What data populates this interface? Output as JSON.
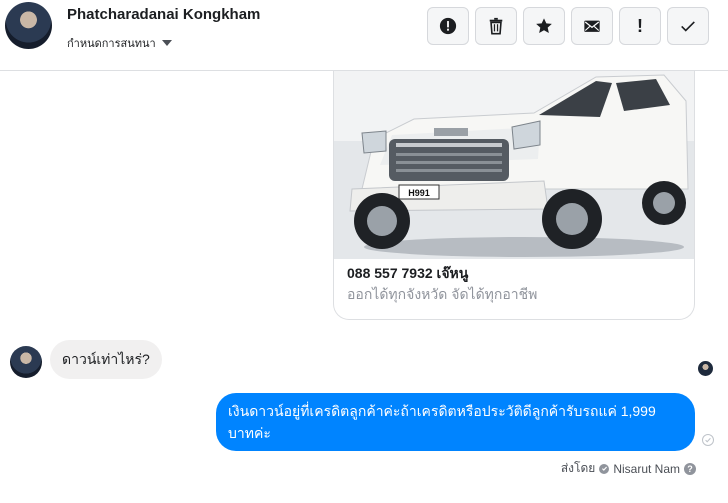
{
  "header": {
    "contact_name": "Phatcharadanai Kongkham",
    "settings_label": "กำหนดการสนทนา",
    "toolbar": [
      {
        "name": "mark-as-spam-button",
        "icon": "exclamation-circle-icon"
      },
      {
        "name": "delete-button",
        "icon": "trash-icon"
      },
      {
        "name": "star-button",
        "icon": "star-icon"
      },
      {
        "name": "mark-unread-button",
        "icon": "envelope-icon"
      },
      {
        "name": "follow-up-button",
        "icon": "exclamation-icon"
      },
      {
        "name": "mark-done-button",
        "icon": "checkmark-icon"
      }
    ]
  },
  "attachment": {
    "image_subject": "white Isuzu pickup truck",
    "plate_text": "H991",
    "title": "088 557 7932 เจ๊หนู",
    "subtitle": "ออกได้ทุกจังหวัด จัดได้ทุกอาชีพ"
  },
  "messages": {
    "incoming": "ดาวน์เท่าไหร่?",
    "outgoing": "เงินดาวน์อยู่ที่เครดิตลูกค้าค่ะถ้าเครดิตหรือประวัติดีลูกค้ารับรถแค่ 1,999 บาทค่ะ"
  },
  "sender": {
    "prefix": "ส่งโดย",
    "name": "Nisarut Nam"
  },
  "colors": {
    "outgoing_bubble": "#0084ff",
    "incoming_bubble": "#f1f0f0",
    "muted_text": "#90949c"
  }
}
